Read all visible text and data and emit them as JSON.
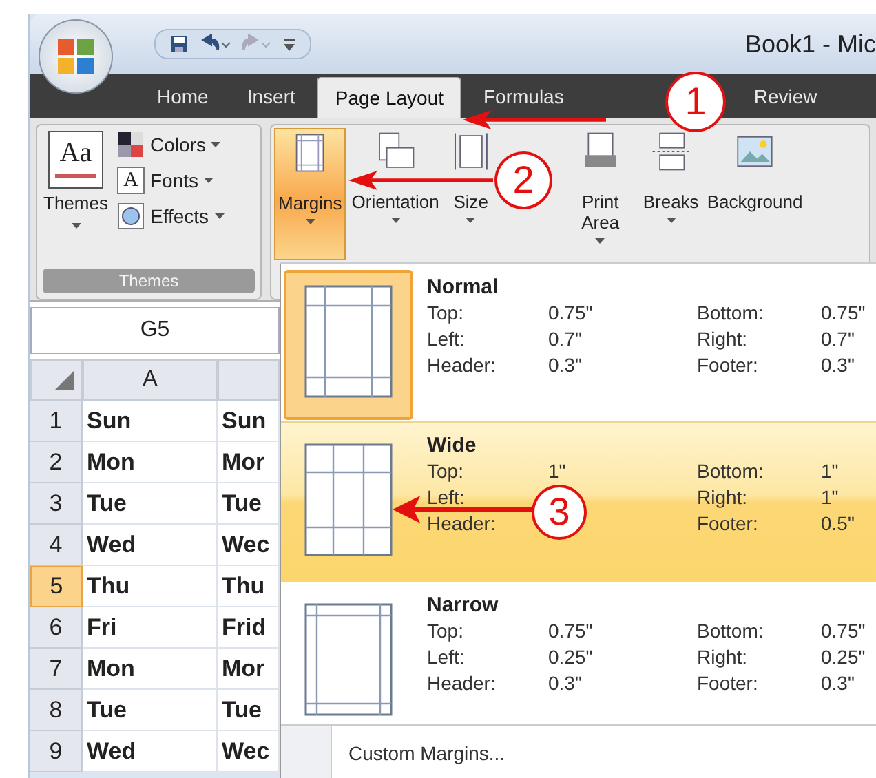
{
  "title_bar": {
    "title": "Book1 - Mic"
  },
  "tabs": [
    {
      "label": "Home",
      "selected": false
    },
    {
      "label": "Insert",
      "selected": false
    },
    {
      "label": "Page Layout",
      "selected": true
    },
    {
      "label": "Formulas",
      "selected": false
    },
    {
      "label": "Review",
      "selected": false
    }
  ],
  "themes_group": {
    "preview_text": "Aa",
    "big_button": "Themes",
    "items": [
      {
        "label": "Colors"
      },
      {
        "label": "Fonts",
        "icon_text": "A"
      },
      {
        "label": "Effects"
      }
    ],
    "label": "Themes"
  },
  "page_setup": [
    {
      "label": "Margins",
      "selected": true,
      "dropdown": true
    },
    {
      "label": "Orientation",
      "selected": false,
      "dropdown": true
    },
    {
      "label": "Size",
      "selected": false,
      "dropdown": true
    },
    {
      "label": "Print Area",
      "selected": false,
      "dropdown": true
    },
    {
      "label": "Breaks",
      "selected": false,
      "dropdown": true
    },
    {
      "label": "Background",
      "selected": false,
      "dropdown": false
    }
  ],
  "name_box": "G5",
  "columns": [
    "A"
  ],
  "rows": [
    {
      "number": "1",
      "selected": false,
      "cells": [
        "Sun",
        "Sun"
      ]
    },
    {
      "number": "2",
      "selected": false,
      "cells": [
        "Mon",
        "Mor"
      ]
    },
    {
      "number": "3",
      "selected": false,
      "cells": [
        "Tue",
        "Tue"
      ]
    },
    {
      "number": "4",
      "selected": false,
      "cells": [
        "Wed",
        "Wec"
      ]
    },
    {
      "number": "5",
      "selected": true,
      "cells": [
        "Thu",
        "Thu"
      ]
    },
    {
      "number": "6",
      "selected": false,
      "cells": [
        "Fri",
        "Frid"
      ]
    },
    {
      "number": "7",
      "selected": false,
      "cells": [
        "Mon",
        "Mor"
      ]
    },
    {
      "number": "8",
      "selected": false,
      "cells": [
        "Tue",
        "Tue"
      ]
    },
    {
      "number": "9",
      "selected": false,
      "cells": [
        "Wed",
        "Wec"
      ]
    }
  ],
  "margins_menu": {
    "options": [
      {
        "name": "Normal",
        "current": true,
        "selected": false,
        "fields": [
          {
            "label": "Top:",
            "value": "0.75\""
          },
          {
            "label": "Bottom:",
            "value": "0.75\""
          },
          {
            "label": "Left:",
            "value": "0.7\""
          },
          {
            "label": "Right:",
            "value": "0.7\""
          },
          {
            "label": "Header:",
            "value": "0.3\""
          },
          {
            "label": "Footer:",
            "value": "0.3\""
          }
        ]
      },
      {
        "name": "Wide",
        "current": false,
        "selected": true,
        "fields": [
          {
            "label": "Top:",
            "value": "1\""
          },
          {
            "label": "Bottom:",
            "value": "1\""
          },
          {
            "label": "Left:"
          },
          {
            "label": "Right:",
            "value": "1\""
          },
          {
            "label": "Header:"
          },
          {
            "label": "Footer:",
            "value": "0.5\""
          }
        ]
      },
      {
        "name": "Narrow",
        "current": false,
        "selected": false,
        "fields": [
          {
            "label": "Top:",
            "value": "0.75\""
          },
          {
            "label": "Bottom:",
            "value": "0.75\""
          },
          {
            "label": "Left:",
            "value": "0.25\""
          },
          {
            "label": "Right:",
            "value": "0.25\""
          },
          {
            "label": "Header:",
            "value": "0.3\""
          },
          {
            "label": "Footer:",
            "value": "0.3\""
          }
        ]
      }
    ],
    "custom": "Custom Margins..."
  },
  "annotations": [
    "1",
    "2",
    "3"
  ]
}
